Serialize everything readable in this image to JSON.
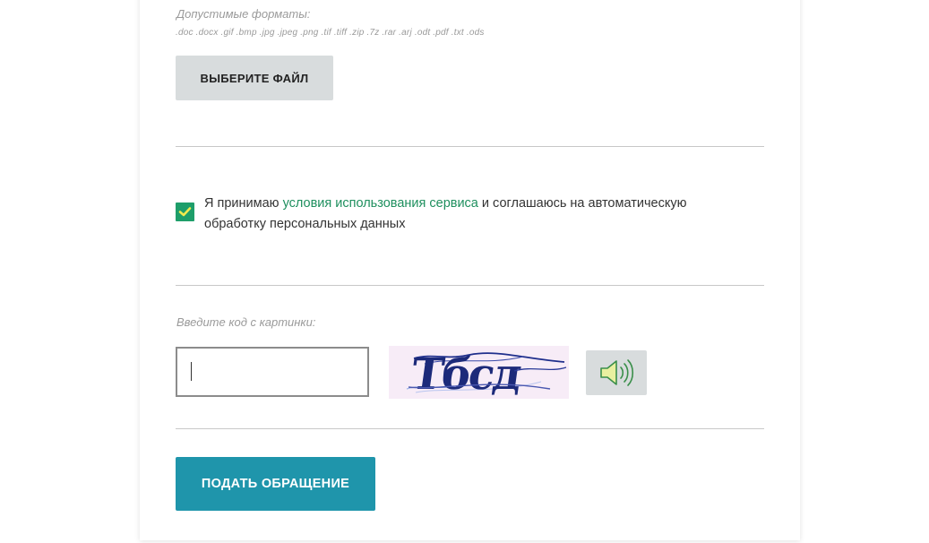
{
  "upload": {
    "formats_label": "Допустимые форматы:",
    "formats_list": ".doc .docx .gif .bmp .jpg .jpeg .png .tif .tiff .zip .7z .rar .arj .odt .pdf .txt .ods",
    "choose_file_label": "ВЫБЕРИТЕ ФАЙЛ"
  },
  "consent": {
    "checked": true,
    "text_before": "Я принимаю ",
    "link_text": "условия использования сервиса",
    "text_after": " и соглашаюсь на автоматическую обработку персональных данных"
  },
  "captcha": {
    "label": "Введите код с картинки:",
    "input_value": "",
    "image_text": "Тбсд",
    "audio_icon": "speaker-icon"
  },
  "submit": {
    "label": "ПОДАТЬ ОБРАЩЕНИЕ"
  },
  "colors": {
    "accent_green": "#1e9e6a",
    "link_green": "#1e8f5e",
    "submit_teal": "#1f95ab",
    "button_gray": "#d8dcdd",
    "checkmark_yellow": "#f2e94e"
  }
}
